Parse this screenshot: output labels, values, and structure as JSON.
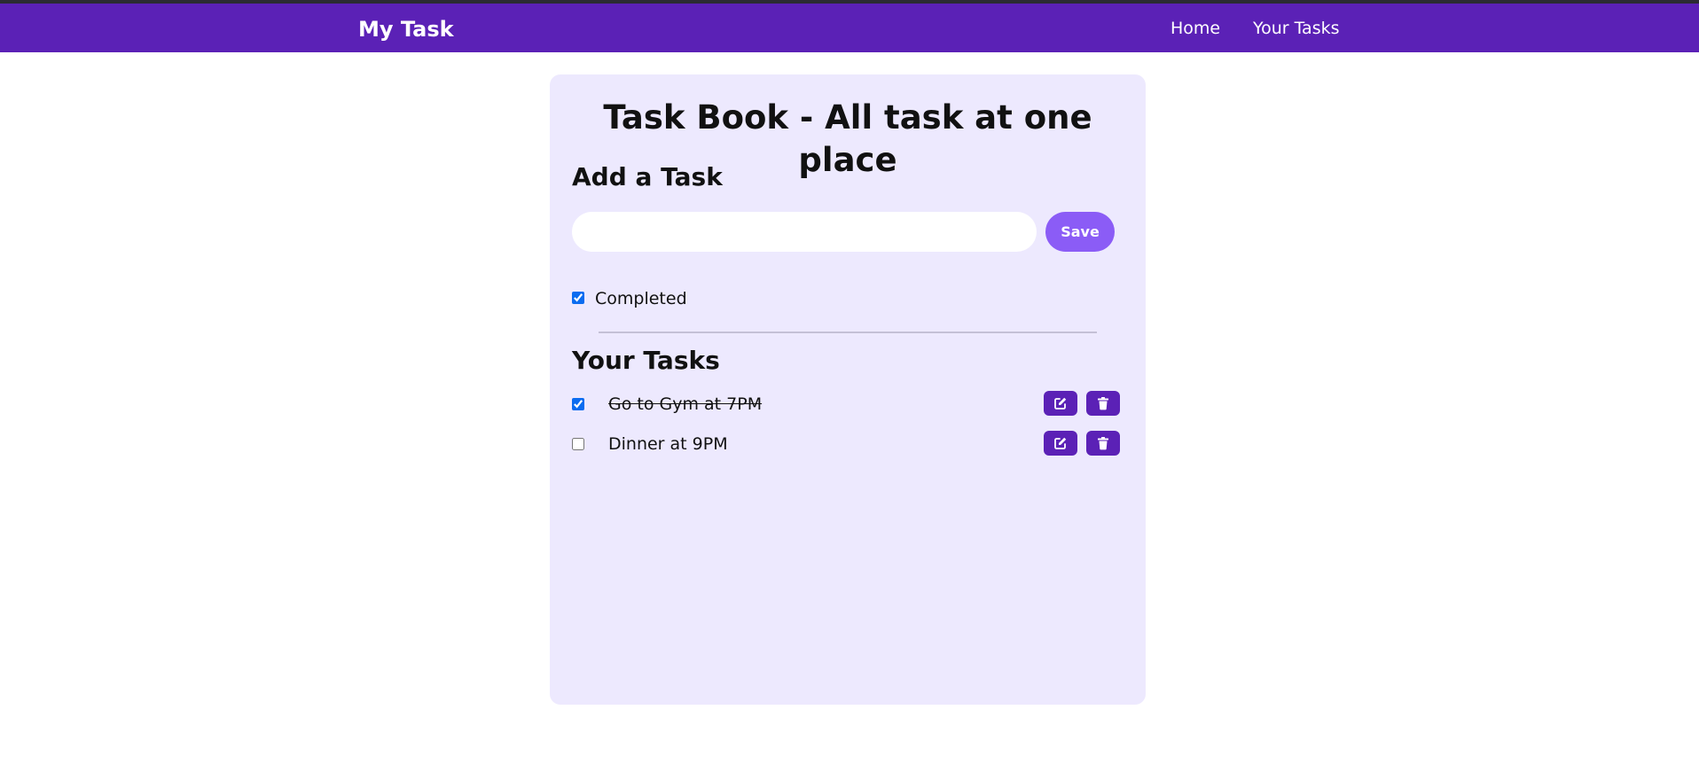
{
  "navbar": {
    "brand": "My Task",
    "links": [
      {
        "label": "Home"
      },
      {
        "label": "Your Tasks"
      }
    ],
    "color": "#5b21b6"
  },
  "main": {
    "title": "Task Book - All task at one place",
    "add_section": {
      "heading": "Add a Task",
      "input_value": "",
      "save_label": "Save",
      "completed_label": "Completed",
      "completed_checked": true
    },
    "tasks_section": {
      "heading": "Your Tasks",
      "tasks": [
        {
          "text": "Go to Gym at 7PM",
          "completed": true,
          "edit_icon": "edit-icon",
          "delete_icon": "trash-icon"
        },
        {
          "text": "Dinner at 9PM",
          "completed": false,
          "edit_icon": "edit-icon",
          "delete_icon": "trash-icon"
        }
      ]
    }
  },
  "colors": {
    "accent": "#5b21b6",
    "save_button": "#8b5cf6",
    "card_background": "#ede9fe"
  }
}
